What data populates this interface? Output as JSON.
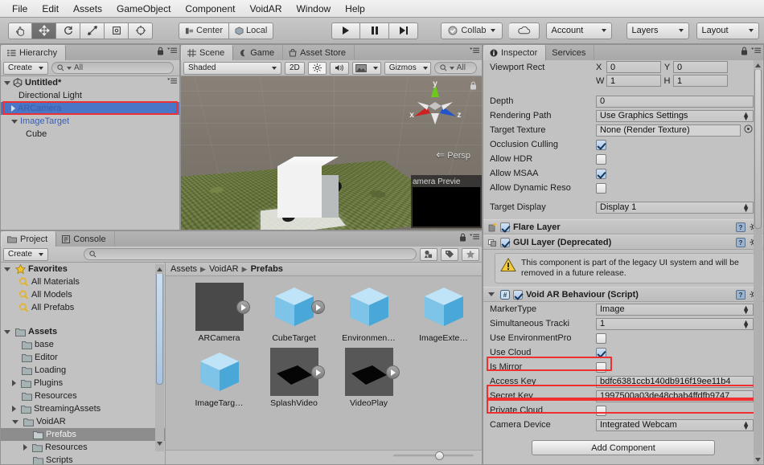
{
  "menubar": {
    "items": [
      "File",
      "Edit",
      "Assets",
      "GameObject",
      "Component",
      "VoidAR",
      "Window",
      "Help"
    ]
  },
  "toolbar": {
    "transform_tools": [
      "hand-tool",
      "move-tool",
      "rotate-tool",
      "scale-tool",
      "rect-tool",
      "transform-tool"
    ],
    "pivot_mode": "Center",
    "pivot_rotation": "Local",
    "play": "play-icon",
    "pause": "pause-icon",
    "step": "step-icon",
    "collab": "Collab",
    "cloud": "cloud-icon",
    "account": "Account",
    "layers": "Layers",
    "layout": "Layout"
  },
  "hierarchy": {
    "tab": "Hierarchy",
    "create_button": "Create",
    "search_placeholder": "All",
    "scene_name": "Untitled*",
    "items": [
      {
        "label": "Directional Light",
        "depth": 1,
        "arrow": "none",
        "selected": false,
        "prefab": false
      },
      {
        "label": "ARCamera",
        "depth": 1,
        "arrow": "closed",
        "selected": true,
        "prefab": true
      },
      {
        "label": "ImageTarget",
        "depth": 1,
        "arrow": "open",
        "selected": false,
        "prefab": true
      },
      {
        "label": "Cube",
        "depth": 2,
        "arrow": "none",
        "selected": false,
        "prefab": false
      }
    ]
  },
  "scene": {
    "tabs": [
      "Scene",
      "Game",
      "Asset Store"
    ],
    "active_tab": "Scene",
    "shading_mode": "Shaded",
    "mode_2d": "2D",
    "gizmos": "Gizmos",
    "search_placeholder": "All",
    "persp_label": "Persp",
    "gizmo_axes": {
      "x": "x",
      "y": "y",
      "z": "z"
    },
    "camera_preview_title": "amera Previe"
  },
  "inspector": {
    "tabs": [
      "Inspector",
      "Services"
    ],
    "active_tab": "Inspector",
    "camera_props": {
      "viewport_rect_label": "Viewport Rect",
      "x_label": "X",
      "x_value": "0",
      "y_label": "Y",
      "y_value": "0",
      "w_label": "W",
      "w_value": "1",
      "h_label": "H",
      "h_value": "1",
      "depth_label": "Depth",
      "depth_value": "0",
      "rendering_path_label": "Rendering Path",
      "rendering_path_value": "Use Graphics Settings",
      "target_texture_label": "Target Texture",
      "target_texture_value": "None (Render Texture)",
      "occlusion_culling_label": "Occlusion Culling",
      "occlusion_culling_checked": true,
      "allow_hdr_label": "Allow HDR",
      "allow_hdr_checked": false,
      "allow_msaa_label": "Allow MSAA",
      "allow_msaa_checked": true,
      "allow_dynamic_label": "Allow Dynamic Reso",
      "allow_dynamic_checked": false,
      "target_display_label": "Target Display",
      "target_display_value": "Display 1"
    },
    "flare_layer": {
      "title": "Flare Layer",
      "enabled": true
    },
    "gui_layer": {
      "title": "GUI Layer (Deprecated)",
      "enabled": true,
      "warning": "This component is part of the legacy UI system and will be removed in a future release."
    },
    "void_ar": {
      "title": "Void AR Behaviour (Script)",
      "enabled": true,
      "marker_type_label": "MarkerType",
      "marker_type_value": "Image",
      "simultaneous_label": "Simultaneous Tracki",
      "simultaneous_value": "1",
      "use_env_label": "Use EnvironmentPro",
      "use_env_checked": false,
      "use_cloud_label": "Use Cloud",
      "use_cloud_checked": true,
      "is_mirror_label": "Is Mirror",
      "is_mirror_checked": false,
      "access_key_label": "Access Key",
      "access_key_value": "bdfc6381ccb140db916f19ee11b4",
      "secret_key_label": "Secret Key",
      "secret_key_value": "1997500a03de48cbab4ffdfb9747",
      "private_cloud_label": "Private Cloud",
      "private_cloud_checked": false,
      "camera_device_label": "Camera Device",
      "camera_device_value": "Integrated Webcam"
    },
    "add_component": "Add Component"
  },
  "project": {
    "tabs": [
      "Project",
      "Console"
    ],
    "active_tab": "Project",
    "create_button": "Create",
    "search_placeholder": "",
    "tree": [
      {
        "label": "Favorites",
        "depth": 0,
        "arrow": "open",
        "icon": "star-icon",
        "bold": true,
        "selected": false
      },
      {
        "label": "All Materials",
        "depth": 1,
        "arrow": "none",
        "icon": "search-icon",
        "bold": false,
        "selected": false
      },
      {
        "label": "All Models",
        "depth": 1,
        "arrow": "none",
        "icon": "search-icon",
        "bold": false,
        "selected": false
      },
      {
        "label": "All Prefabs",
        "depth": 1,
        "arrow": "none",
        "icon": "search-icon",
        "bold": false,
        "selected": false
      },
      {
        "label": "",
        "depth": 0,
        "arrow": "none",
        "icon": "none",
        "bold": false,
        "selected": false
      },
      {
        "label": "Assets",
        "depth": 0,
        "arrow": "open",
        "icon": "folder-icon",
        "bold": true,
        "selected": false
      },
      {
        "label": "base",
        "depth": 1,
        "arrow": "none",
        "icon": "folder-icon",
        "bold": false,
        "selected": false
      },
      {
        "label": "Editor",
        "depth": 1,
        "arrow": "none",
        "icon": "folder-icon",
        "bold": false,
        "selected": false
      },
      {
        "label": "Loading",
        "depth": 1,
        "arrow": "none",
        "icon": "folder-icon",
        "bold": false,
        "selected": false
      },
      {
        "label": "Plugins",
        "depth": 1,
        "arrow": "closed",
        "icon": "folder-icon",
        "bold": false,
        "selected": false
      },
      {
        "label": "Resources",
        "depth": 1,
        "arrow": "none",
        "icon": "folder-icon",
        "bold": false,
        "selected": false
      },
      {
        "label": "StreamingAssets",
        "depth": 1,
        "arrow": "closed",
        "icon": "folder-icon",
        "bold": false,
        "selected": false
      },
      {
        "label": "VoidAR",
        "depth": 1,
        "arrow": "open",
        "icon": "folder-icon",
        "bold": false,
        "selected": false
      },
      {
        "label": "Prefabs",
        "depth": 2,
        "arrow": "none",
        "icon": "folder-icon",
        "bold": false,
        "selected": true
      },
      {
        "label": "Resources",
        "depth": 2,
        "arrow": "closed",
        "icon": "folder-icon",
        "bold": false,
        "selected": false
      },
      {
        "label": "Scripts",
        "depth": 2,
        "arrow": "none",
        "icon": "folder-icon",
        "bold": false,
        "selected": false
      }
    ],
    "breadcrumb": [
      "Assets",
      "VoidAR",
      "Prefabs"
    ],
    "assets": [
      {
        "name": "ARCamera",
        "thumb": "dark",
        "play": true
      },
      {
        "name": "CubeTarget",
        "thumb": "cube",
        "play": true
      },
      {
        "name": "Environmen…",
        "thumb": "cube",
        "play": false
      },
      {
        "name": "ImageExte…",
        "thumb": "cube",
        "play": false
      },
      {
        "name": "ImageTarg…",
        "thumb": "cube",
        "play": false
      },
      {
        "name": "SplashVideo",
        "thumb": "plane",
        "play": true
      },
      {
        "name": "VideoPlay",
        "thumb": "plane",
        "play": true
      }
    ]
  },
  "colors": {
    "highlight_red": "#f03030",
    "selection_blue": "#4a76c8",
    "panel_bg": "#c2c2c2"
  }
}
